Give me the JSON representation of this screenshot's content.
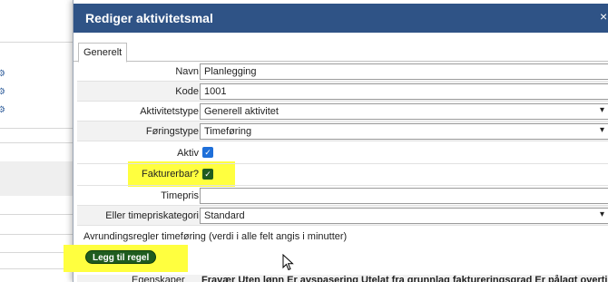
{
  "dialog": {
    "title": "Rediger aktivitetsmal",
    "close_label": "×"
  },
  "tabs": [
    {
      "label": "Generelt"
    }
  ],
  "form": {
    "navn_label": "Navn",
    "navn_value": "Planlegging",
    "kode_label": "Kode",
    "kode_value": "1001",
    "aktivitetstype_label": "Aktivitetstype",
    "aktivitetstype_value": "Generell aktivitet",
    "foringstype_label": "Føringstype",
    "foringstype_value": "Timeføring",
    "aktiv_label": "Aktiv",
    "aktiv_checked": true,
    "fakturerbar_label": "Fakturerbar?",
    "fakturerbar_checked": true,
    "timepris_label": "Timepris",
    "timepris_value": "",
    "timepriskategori_label": "Eller timepriskategori",
    "timepriskategori_value": "Standard",
    "required_mark": "*"
  },
  "rounding": {
    "text": "Avrundingsregler timeføring (verdi i alle felt angis i minutter)",
    "add_button": "Legg til regel"
  },
  "bottom": {
    "label": "Egenskaper",
    "value": "Fravær  Uten lønn  Er avspasering  Utelat fra grunnlag faktureringsgrad  Er pålagt overtid"
  },
  "colors": {
    "header": "#2f5386",
    "highlight": "#ffff3f",
    "button": "#1f5c1f",
    "checkbox": "#1e6fd9"
  }
}
